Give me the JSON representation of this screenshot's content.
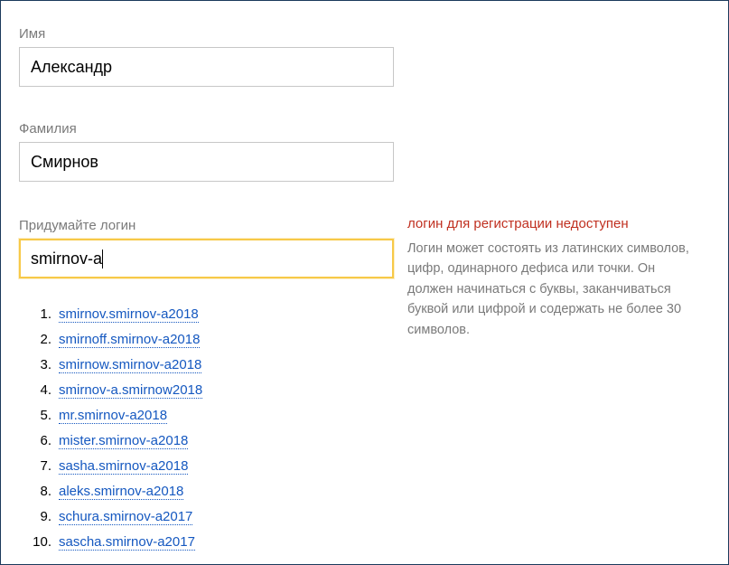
{
  "fields": {
    "first_name": {
      "label": "Имя",
      "value": "Александр"
    },
    "last_name": {
      "label": "Фамилия",
      "value": "Смирнов"
    },
    "login": {
      "label": "Придумайте логин",
      "value": "smirnov-a"
    }
  },
  "error": {
    "title": "логин для регистрации недоступен",
    "hint": "Логин может состоять из латинских символов, цифр, одинарного дефиса или точки. Он должен начинаться с буквы, заканчиваться буквой или цифрой и содержать не более 30 символов."
  },
  "suggestions": [
    "smirnov.smirnov-a2018",
    "smirnoff.smirnov-a2018",
    "smirnow.smirnov-a2018",
    "smirnov-a.smirnow2018",
    "mr.smirnov-a2018",
    "mister.smirnov-a2018",
    "sasha.smirnov-a2018",
    "aleks.smirnov-a2018",
    "schura.smirnov-a2017",
    "sascha.smirnov-a2017"
  ]
}
